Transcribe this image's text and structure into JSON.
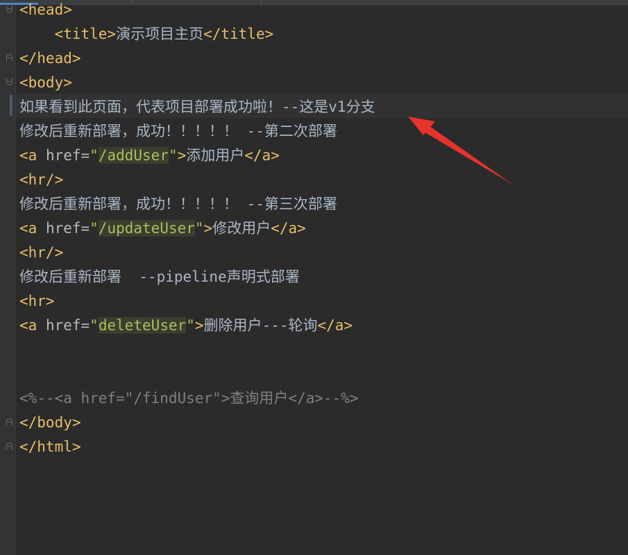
{
  "editor": {
    "colors": {
      "background": "#2b2b2b",
      "tag": "#e8bf6a",
      "attribute": "#bababa",
      "string": "#a5c25c",
      "text": "#a9b7c6",
      "comment": "#808080",
      "annotation_arrow": "#e8322c"
    },
    "lines": {
      "head_open": "<head>",
      "title_open": "<title>",
      "title_text": "演示项目主页",
      "title_close": "</title>",
      "head_close": "</head>",
      "body_open": "<body>",
      "text1": "如果看到此页面，代表项目部署成功啦！--这是v1分支",
      "text2": "修改后重新部署，成功！！！！！ --第二次部署",
      "a1_open": "<a",
      "a1_attr": " href=",
      "a1_q1": "\"",
      "a1_href": "/addUser",
      "a1_q2": "\"",
      "a1_gt": ">",
      "a1_text": "添加用户",
      "a1_close": "</a>",
      "hr1": "<hr/>",
      "text3": "修改后重新部署，成功！！！！！ --第三次部署",
      "a2_open": "<a",
      "a2_attr": " href=",
      "a2_q1": "\"",
      "a2_href": "/updateUser",
      "a2_q2": "\"",
      "a2_gt": ">",
      "a2_text": "修改用户",
      "a2_close": "</a>",
      "hr2": "<hr/>",
      "text4": "修改后重新部署  --pipeline声明式部署",
      "hr3": "<hr>",
      "a3_open": "<a",
      "a3_attr": " href=",
      "a3_q1": "\"",
      "a3_href": "deleteUser",
      "a3_q2": "\"",
      "a3_gt": ">",
      "a3_text": "删除用户---轮询",
      "a3_close": "</a>",
      "comment": "<%--<a href=\"/findUser\">查询用户</a>--%>",
      "body_close": "</body>",
      "html_close": "</html>"
    }
  }
}
